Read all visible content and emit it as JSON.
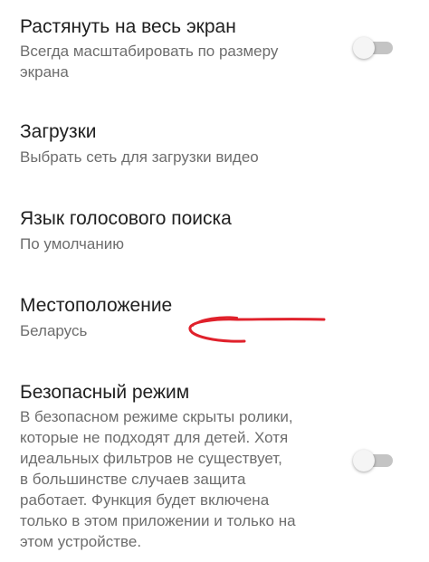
{
  "settings": {
    "fullscreen": {
      "title": "Растянуть на весь экран",
      "summary_lines": [
        "Всегда масштабировать по размеру",
        "экрана"
      ],
      "toggle_on": false
    },
    "downloads": {
      "title": "Загрузки",
      "summary": "Выбрать сеть для загрузки видео"
    },
    "voice_search_language": {
      "title": "Язык голосового поиска",
      "summary": "По умолчанию"
    },
    "location": {
      "title": "Местоположение",
      "summary": "Беларусь"
    },
    "safe_mode": {
      "title": "Безопасный режим",
      "summary_lines": [
        "В безопасном режиме скрыты ролики,",
        "которые не подходят для детей. Хотя",
        "идеальных фильтров не существует,",
        "в большинстве случаев защита",
        "работает. Функция будет включена",
        "только в этом приложении и только на",
        "этом устройстве."
      ],
      "toggle_on": false
    }
  },
  "colors": {
    "title_text": "#202020",
    "summary_text": "#6d6d6d",
    "switch_track_off": "#c4c4c4",
    "switch_thumb_off": "#f5f5f5",
    "annotation_stroke": "#e0212b"
  },
  "icons": {
    "annotation": "red-hand-drawn-arrow"
  }
}
